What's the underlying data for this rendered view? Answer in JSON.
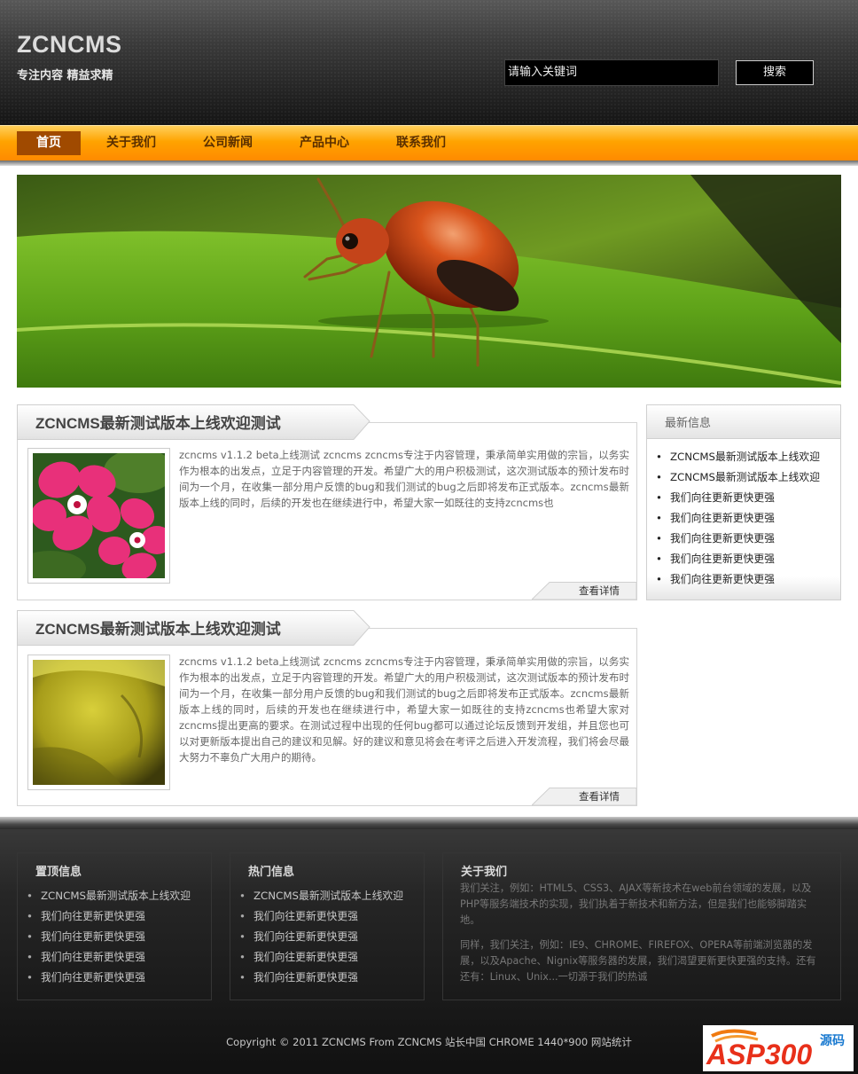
{
  "header": {
    "logo": "ZCNCMS",
    "slogan": "专注内容  精益求精",
    "search_value": "请输入关键词",
    "search_button": "搜索"
  },
  "nav": {
    "items": [
      "首页",
      "关于我们",
      "公司新闻",
      "产品中心",
      "联系我们"
    ],
    "active_index": 0
  },
  "articles": [
    {
      "title": "ZCNCMS最新测试版本上线欢迎测试",
      "text": "zcncms v1.1.2 beta上线测试 zcncms zcncms专注于内容管理，秉承简单实用做的宗旨，以务实作为根本的出发点，立足于内容管理的开发。希望广大的用户积极测试，这次测试版本的预计发布时间为一个月，在收集一部分用户反馈的bug和我们测试的bug之后即将发布正式版本。zcncms最新版本上线的同时，后续的开发也在继续进行中，希望大家一如既往的支持zcncms也",
      "more": "查看详情",
      "image": "pink-flowers"
    },
    {
      "title": "ZCNCMS最新测试版本上线欢迎测试",
      "text": "zcncms v1.1.2 beta上线测试 zcncms zcncms专注于内容管理，秉承简单实用做的宗旨，以务实作为根本的出发点，立足于内容管理的开发。希望广大的用户积极测试，这次测试版本的预计发布时间为一个月，在收集一部分用户反馈的bug和我们测试的bug之后即将发布正式版本。zcncms最新版本上线的同时，后续的开发也在继续进行中，希望大家一如既往的支持zcncms也希望大家对zcncms提出更高的要求。在测试过程中出现的任何bug都可以通过论坛反馈到开发组，并且您也可以对更新版本提出自己的建议和见解。好的建议和意见将会在考评之后进入开发流程，我们将会尽最大努力不辜负广大用户的期待。",
      "more": "查看详情",
      "image": "yellow-flower"
    }
  ],
  "sidebar": {
    "title": "最新信息",
    "items": [
      "ZCNCMS最新测试版本上线欢迎",
      "ZCNCMS最新测试版本上线欢迎",
      "我们向往更新更快更强",
      "我们向往更新更快更强",
      "我们向往更新更快更强",
      "我们向往更新更快更强",
      "我们向往更新更快更强"
    ]
  },
  "footer": {
    "col1": {
      "title": "置顶信息",
      "items": [
        "ZCNCMS最新测试版本上线欢迎",
        "我们向往更新更快更强",
        "我们向往更新更快更强",
        "我们向往更新更快更强",
        "我们向往更新更快更强"
      ]
    },
    "col2": {
      "title": "热门信息",
      "items": [
        "ZCNCMS最新测试版本上线欢迎",
        "我们向往更新更快更强",
        "我们向往更新更快更强",
        "我们向往更新更快更强",
        "我们向往更新更快更强"
      ]
    },
    "col3": {
      "title": "关于我们",
      "para1": "我们关注，例如：HTML5、CSS3、AJAX等新技术在web前台领域的发展，以及PHP等服务端技术的实现，我们执着于新技术和新方法，但是我们也能够脚踏实地。",
      "para2": "同样，我们关注，例如：IE9、CHROME、FIREFOX、OPERA等前端浏览器的发展，以及Apache、Nignix等服务器的发展，我们渴望更新更快更强的支持。还有还有：Linux、Unix...一切源于我们的热诚"
    },
    "copyright": "Copyright © 2011 ZCNCMS From ZCNCMS 站长中国  CHROME 1440*900 网站统计"
  },
  "watermark": {
    "text": "ASP300",
    "sub": "源码"
  },
  "colors": {
    "nav_orange": "#ffa300",
    "nav_active": "#a04a00",
    "footer_bg": "#222222"
  }
}
